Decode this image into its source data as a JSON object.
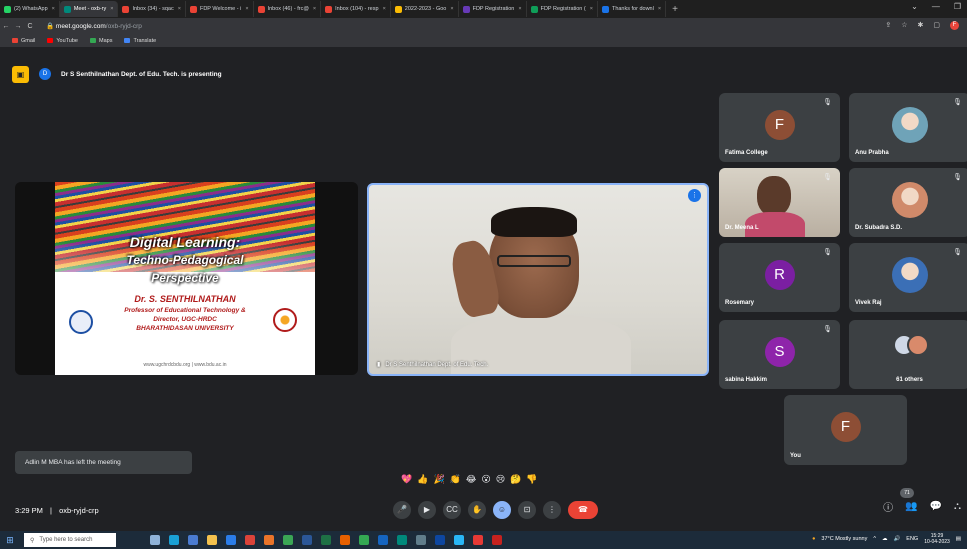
{
  "browser": {
    "tabs": [
      {
        "label": "(2) WhatsApp",
        "color": "#25d366"
      },
      {
        "label": "Meet - oxb-ry",
        "color": "#00897b",
        "active": true
      },
      {
        "label": "Inbox (34) - sqac",
        "color": "#ea4335"
      },
      {
        "label": "FDP Welcome - i",
        "color": "#ea4335"
      },
      {
        "label": "Inbox (46) - frc@",
        "color": "#ea4335"
      },
      {
        "label": "Inbox (104) - resp",
        "color": "#ea4335"
      },
      {
        "label": "2022-2023 - Goo",
        "color": "#fbbc04"
      },
      {
        "label": "FDP Registration",
        "color": "#673ab7"
      },
      {
        "label": "FDP Registration (",
        "color": "#0f9d58"
      },
      {
        "label": "Thanks for downl",
        "color": "#1a73e8"
      }
    ],
    "new_tab": "+",
    "url_host": "meet.google.com",
    "url_path": "/oxb-ryjd-crp",
    "profile_initial": "F",
    "bookmarks": [
      {
        "label": "Gmail",
        "color": "#ea4335"
      },
      {
        "label": "YouTube",
        "color": "#ff0000"
      },
      {
        "label": "Maps",
        "color": "#34a853"
      },
      {
        "label": "Translate",
        "color": "#4285f4"
      }
    ]
  },
  "meet": {
    "presenter_initial": "D",
    "presenting_text": "Dr S Senthilnathan Dept. of Edu. Tech. is presenting",
    "slide": {
      "title1": "Digital Learning:",
      "title2": "Techno-Pedagogical",
      "title3": "Perspective",
      "author": "Dr. S. SENTHILNATHAN",
      "line1": "Professor of Educational Technology &",
      "line2": "Director, UGC-HRDC",
      "line3": "BHARATHIDASAN UNIVERSITY",
      "url": "www.ugchrdcbdu.org | www.bdu.ac.in"
    },
    "speaker_name": "Dr S Senthilnathan Dept. of Edu. Tech.",
    "participants": [
      {
        "name": "Fatima College",
        "initial": "F",
        "color": "#8d4e35",
        "kind": "letter"
      },
      {
        "name": "Anu Prabha",
        "initial": "",
        "color": "#6fa3b8",
        "kind": "photo"
      },
      {
        "name": "Dr. Meena L",
        "initial": "",
        "color": "#c9b79c",
        "kind": "video"
      },
      {
        "name": "Dr. Subadra S.D.",
        "initial": "",
        "color": "#d08a6a",
        "kind": "photo"
      },
      {
        "name": "Rosemary",
        "initial": "R",
        "color": "#7b1fa2",
        "kind": "letter"
      },
      {
        "name": "Vivek Raj",
        "initial": "",
        "color": "#3b6fb6",
        "kind": "photo"
      },
      {
        "name": "sabina Hakkim",
        "initial": "S",
        "color": "#8e24aa",
        "kind": "letter"
      },
      {
        "name": "61 others",
        "initial": "",
        "color": "#5f6368",
        "kind": "others"
      }
    ],
    "self_name": "You",
    "self_initial": "F",
    "self_color": "#8d4e35",
    "toast": "Adlin M MBA has left the meeting",
    "reactions": [
      "💖",
      "👍",
      "🎉",
      "👏",
      "😂",
      "😮",
      "😢",
      "🤔",
      "👎"
    ],
    "time": "3:29 PM",
    "separator": "|",
    "meeting_code": "oxb-ryjd-crp",
    "participant_count": "71"
  },
  "taskbar": {
    "search_placeholder": "Type here to search",
    "weather": "37°C  Mostly sunny",
    "lang": "ENG",
    "time": "15:29",
    "date": "10-04-2023"
  }
}
